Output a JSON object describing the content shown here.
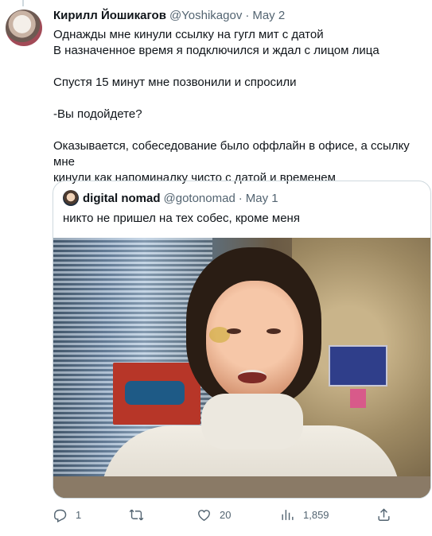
{
  "tweet": {
    "author_name": "Кирилл Йошикагов",
    "author_handle": "@Yoshikagov",
    "separator": "·",
    "date": "May 2",
    "lines": [
      "Однажды мне кинули ссылку на гугл мит с датой",
      "В назначенное время я подключился и ждал с лицом лица",
      "",
      "Спустя 15 минут мне позвонили и спросили",
      "",
      "-Вы подойдете?",
      "",
      "Оказывается, собеседование было оффлайн в офисе, а ссылку мне",
      "кинули как напоминалку чисто с датой и временем"
    ]
  },
  "quote": {
    "author_name": "digital nomad",
    "author_handle": "@gotonomad",
    "separator": "·",
    "date": "May 1",
    "text": "никто не пришел на тех собес, кроме меня"
  },
  "actions": {
    "reply_count": "1",
    "retweet_count": "",
    "like_count": "20",
    "views_count": "1,859"
  },
  "icons": [
    "reply-icon",
    "retweet-icon",
    "like-icon",
    "views-icon",
    "share-icon"
  ],
  "colors": {
    "text": "#0f1419",
    "secondary": "#536471",
    "border": "#cfd9de"
  }
}
